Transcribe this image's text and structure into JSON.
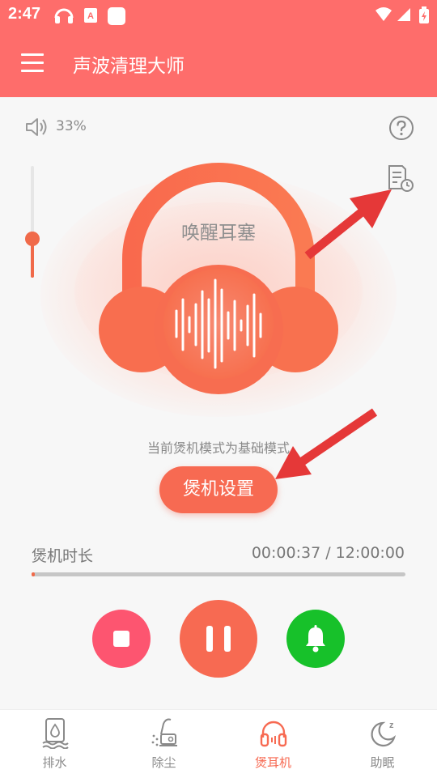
{
  "status_bar": {
    "time": "2:47"
  },
  "header": {
    "title": "声波清理大师"
  },
  "volume": {
    "percent_text": "33%",
    "level": 0.33
  },
  "main": {
    "headphone_label": "唤醒耳塞",
    "mode_text": "当前煲机模式为基础模式",
    "settings_button": "煲机设置"
  },
  "duration": {
    "label": "煲机时长",
    "value": "00:00:37 / 12:00:00",
    "progress": 0.0009
  },
  "colors": {
    "brand": "#fe6d6b",
    "accent": "#f76a52",
    "stop": "#fd5570",
    "bell": "#17c12a"
  },
  "nav": {
    "items": [
      {
        "label": "排水",
        "icon": "drain-icon"
      },
      {
        "label": "除尘",
        "icon": "dust-cleaner-icon"
      },
      {
        "label": "煲耳机",
        "icon": "headphones-icon",
        "active": true
      },
      {
        "label": "助眠",
        "icon": "sleep-moon-icon"
      }
    ]
  }
}
